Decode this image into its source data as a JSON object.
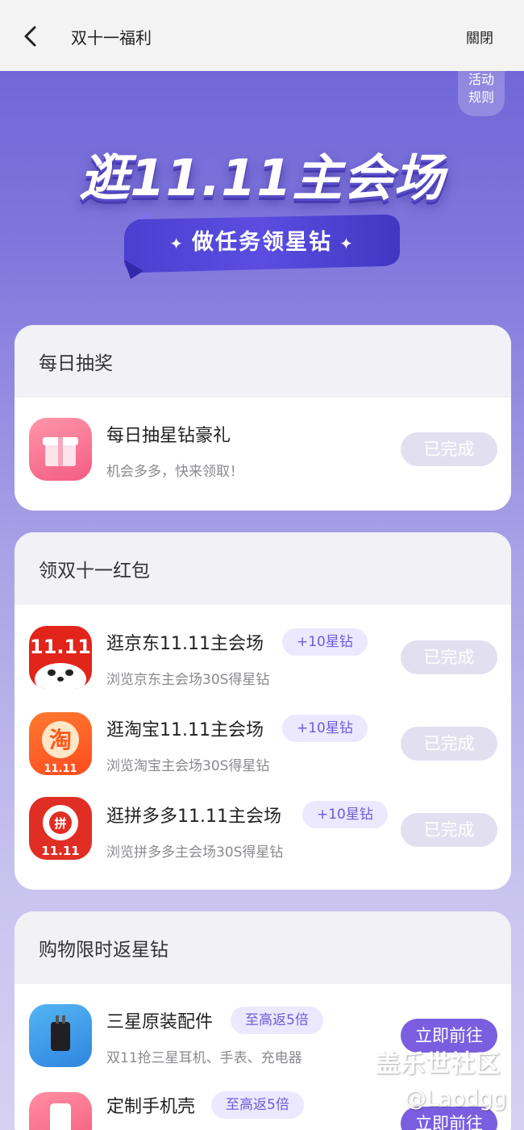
{
  "topbar": {
    "title": "双十一福利",
    "close_label": "關閉"
  },
  "rules_button": "活动规则",
  "banner": {
    "title": "逛11.11主会场",
    "subtitle": "做任务领星钻"
  },
  "daily_lottery": {
    "heading": "每日抽奖",
    "items": [
      {
        "title": "每日抽星钻豪礼",
        "subtitle": "机会多多，快来领取！",
        "button": "已完成",
        "icon": "gift-icon"
      }
    ]
  },
  "red_packet": {
    "heading": "领双十一红包",
    "items": [
      {
        "title": "逛京东11.11主会场",
        "badge": "+10星钻",
        "subtitle": "浏览京东主会场30S得星钻",
        "button": "已完成",
        "icon": "jd-icon"
      },
      {
        "title": "逛淘宝11.11主会场",
        "badge": "+10星钻",
        "subtitle": "浏览淘宝主会场30S得星钻",
        "button": "已完成",
        "icon": "taobao-icon"
      },
      {
        "title": "逛拼多多11.11主会场",
        "badge": "+10星钻",
        "subtitle": "浏览拼多多主会场30S得星钻",
        "button": "已完成",
        "icon": "pinduoduo-icon"
      }
    ]
  },
  "shopping": {
    "heading": "购物限时返星钻",
    "items": [
      {
        "title": "三星原装配件",
        "badge": "至高返5倍",
        "subtitle": "双11抢三星耳机、手表、充电器",
        "button": "立即前往",
        "icon": "charger-icon"
      },
      {
        "title": "定制手机壳",
        "badge": "至高返5倍",
        "button": "立即前往",
        "icon": "phone-case-icon"
      }
    ]
  },
  "watermark": {
    "line1": "盖乐世社区",
    "line2": "@Laodgg"
  },
  "colors": {
    "accent": "#7b5ee0",
    "badge_bg": "#ece8ff",
    "done_button": "#e2e0f0",
    "jd_red": "#e1251b",
    "taobao_orange": "#ff5a1f",
    "pdd_red": "#e02e24"
  }
}
